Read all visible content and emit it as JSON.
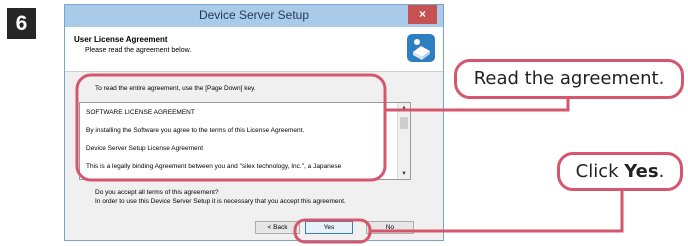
{
  "step_number": "6",
  "window": {
    "title": "Device Server Setup",
    "close_label": "×",
    "header_title": "User License Agreement",
    "header_subtitle": "Please read the agreement below."
  },
  "instruction_text": "To read the entire agreement, use the [Page Down] key.",
  "license": {
    "lines": [
      "SOFTWARE LICENSE AGREEMENT",
      "By installing the Software you agree to the terms of this License Agreement.",
      "Device Server Setup License Agreement",
      "This is a legally binding Agreement between you and \"silex technology, Inc.\", a Japanese"
    ],
    "scroll_up": "▲",
    "scroll_down": "▼"
  },
  "question": {
    "line1": "Do you accept all terms of this agreement?",
    "line2": "In order to use this Device Server Setup it is necessary that you accept this agreement."
  },
  "buttons": {
    "back": "< Back",
    "yes": "Yes",
    "no": "No"
  },
  "callouts": {
    "read": "Read the agreement.",
    "click_prefix": "Click ",
    "click_bold": "Yes",
    "click_suffix": "."
  },
  "colors": {
    "accent": "#d6566e",
    "titlebar": "#a9cbe9",
    "close": "#c75050"
  }
}
